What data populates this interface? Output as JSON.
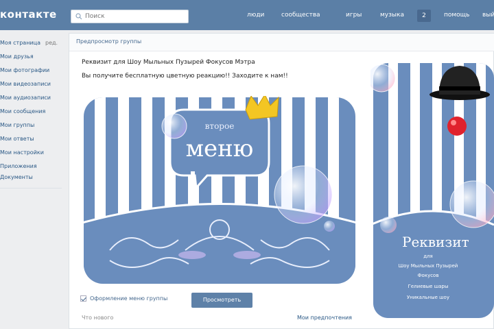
{
  "header": {
    "logo": "контакте",
    "search_placeholder": "Поиск",
    "nav": [
      "люди",
      "сообщества",
      "игры",
      "музыка",
      "помощь",
      "выйти"
    ],
    "music_badge": "2"
  },
  "sidebar": {
    "items": [
      {
        "label": "Моя страница",
        "count": "ред."
      },
      {
        "label": "Мои друзья",
        "count": ""
      },
      {
        "label": "Мои фотографии",
        "count": ""
      },
      {
        "label": "Мои видеозаписи",
        "count": ""
      },
      {
        "label": "Мои аудиозаписи",
        "count": ""
      },
      {
        "label": "Мои сообщения",
        "count": ""
      },
      {
        "label": "Мои группы",
        "count": ""
      },
      {
        "label": "Мои ответы",
        "count": ""
      },
      {
        "label": "Мои настройки",
        "count": ""
      },
      {
        "label": "Приложения",
        "count": ""
      },
      {
        "label": "Документы",
        "count": ""
      }
    ]
  },
  "main": {
    "breadcrumb": "Предпросмотр группы",
    "title_line1": "Реквизит для Шоу Мыльных Пузырей Фокусов Мэтра",
    "title_line2": "Вы получите бесплатную цветную реакцию!! Заходите к нам!!",
    "image1_text_small": "второе",
    "image1_text_big": "меню",
    "image2_text_big": "Реквизит",
    "image2_text_lines": [
      "для",
      "Шоу Мыльных Пузырей",
      "Фокусов",
      "Гелиевые шары",
      "Уникальные шоу"
    ],
    "checkbox_label": "Оформление меню группы",
    "preview_button": "Просмотреть",
    "footer_left": "Что нового",
    "footer_right": "Мои предпочтения"
  },
  "colors": {
    "brand": "#5b7fa6",
    "stripe_blue": "#6a8dbd",
    "stripe_white": "#ffffff",
    "crown": "#f3c623",
    "clown_nose": "#e0222d"
  },
  "icons": {
    "search": "search-icon",
    "crown": "crown-icon",
    "hat": "bowler-hat-icon"
  }
}
